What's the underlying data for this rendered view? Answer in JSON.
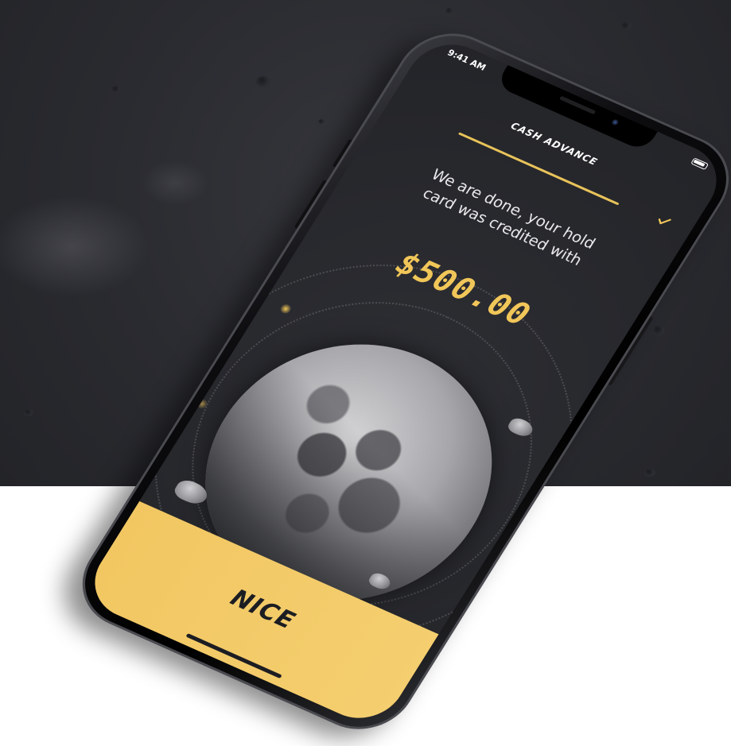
{
  "status_bar": {
    "time": "9:41 AM"
  },
  "header": {
    "title": "CASH ADVANCE"
  },
  "message": {
    "line1": "We are done, your hold",
    "line2": "card was credited with"
  },
  "amount": "$500.00",
  "primary_action": {
    "label": "NICE"
  },
  "colors": {
    "accent": "#f1c659",
    "background": "#2a2b30",
    "button_text": "#1c1d22"
  },
  "icons": {
    "confirm": "check-icon",
    "battery": "battery-icon"
  }
}
